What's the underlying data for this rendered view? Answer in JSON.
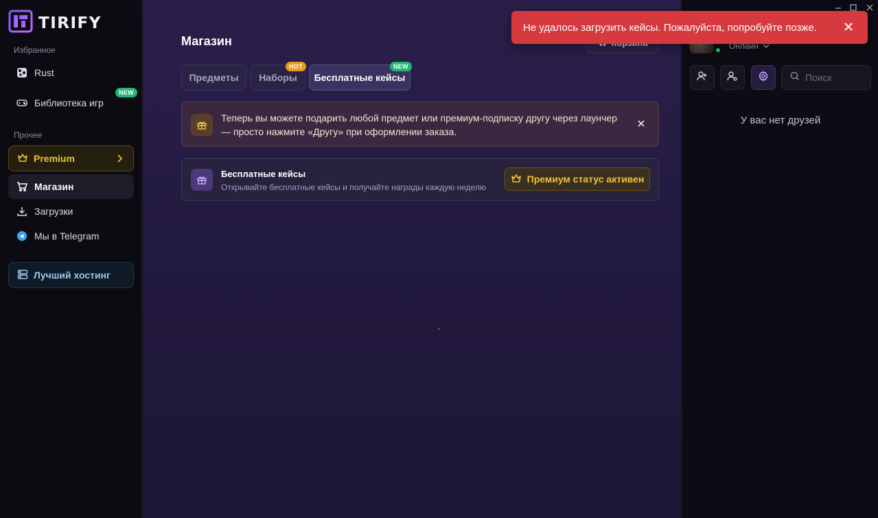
{
  "app": {
    "logo_text": "TIRIFY"
  },
  "sidebar": {
    "favorites_label": "Избранное",
    "favorites": [
      {
        "label": "Rust",
        "icon": "rust-icon"
      },
      {
        "label": "Библиотека игр",
        "icon": "gamepad-icon",
        "badge": "NEW"
      }
    ],
    "other_label": "Прочее",
    "premium_label": "Premium",
    "items": [
      {
        "label": "Магазин",
        "icon": "cart-icon",
        "active": true
      },
      {
        "label": "Загрузки",
        "icon": "download-icon"
      },
      {
        "label": "Мы в Telegram",
        "icon": "telegram-icon"
      }
    ],
    "hosting_label": "Лучший хостинг"
  },
  "main": {
    "title": "Магазин",
    "cart_label": "Корзина",
    "tabs": [
      {
        "label": "Предметы"
      },
      {
        "label": "Наборы",
        "badge": "HOT"
      },
      {
        "label": "Бесплатные кейсы",
        "badge": "NEW",
        "active": true
      }
    ],
    "notice": {
      "text": "Теперь вы можете подарить любой предмет или премиум-подписку другу через лаунчер — просто нажмите «Другу» при оформлении заказа."
    },
    "free_cases": {
      "title": "Бесплатные кейсы",
      "subtitle": "Открывайте бесплатные кейсы и получайте награды каждую неделю",
      "button_label": "Премиум статус активен"
    }
  },
  "friends": {
    "status": "Онлайн",
    "search_placeholder": "Поиск",
    "empty_text": "У вас нет друзей"
  },
  "toast": {
    "message": "Не удалось загрузить кейсы. Пожалуйста, попробуйте позже."
  },
  "colors": {
    "accent_premium": "#f0c23a",
    "new_badge": "#1fb774",
    "hot_badge": "#e89a19",
    "toast_error": "#d63a3f",
    "online": "#22c55e"
  }
}
